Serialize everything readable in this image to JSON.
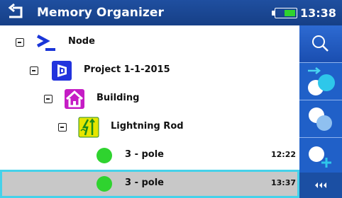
{
  "header": {
    "title": "Memory Organizer",
    "time": "13:38",
    "battery_level": 0.55,
    "background_color": "#1f4fa0",
    "back_icon": "back-arrow-icon"
  },
  "tree": {
    "rows": [
      {
        "label": "Node",
        "icon": "node-prompt-icon",
        "expander": "collapse-icon"
      },
      {
        "label": "Project 1-1-2015",
        "icon": "project-icon",
        "expander": "collapse-icon"
      },
      {
        "label": "Building",
        "icon": "building-icon",
        "expander": "collapse-icon"
      },
      {
        "label": "Lightning Rod",
        "icon": "lightning-rod-icon",
        "expander": "collapse-icon"
      },
      {
        "label": "3 - pole",
        "icon": "result-pass-icon",
        "time": "12:22"
      },
      {
        "label": "3 - pole",
        "icon": "result-pass-icon",
        "time": "13:37",
        "selected": true
      }
    ]
  },
  "toolbar": {
    "buttons": [
      {
        "icon": "search-icon"
      },
      {
        "icon": "start-test-icon"
      },
      {
        "icon": "clone-icon"
      },
      {
        "icon": "add-test-icon"
      },
      {
        "icon": "more-options-icon"
      }
    ]
  },
  "colors": {
    "selection_border": "#45d2ea",
    "selection_fill": "#c8c8c8",
    "pass_green": "#2fd32f",
    "toolbar_blue": "#1b4fa3"
  }
}
